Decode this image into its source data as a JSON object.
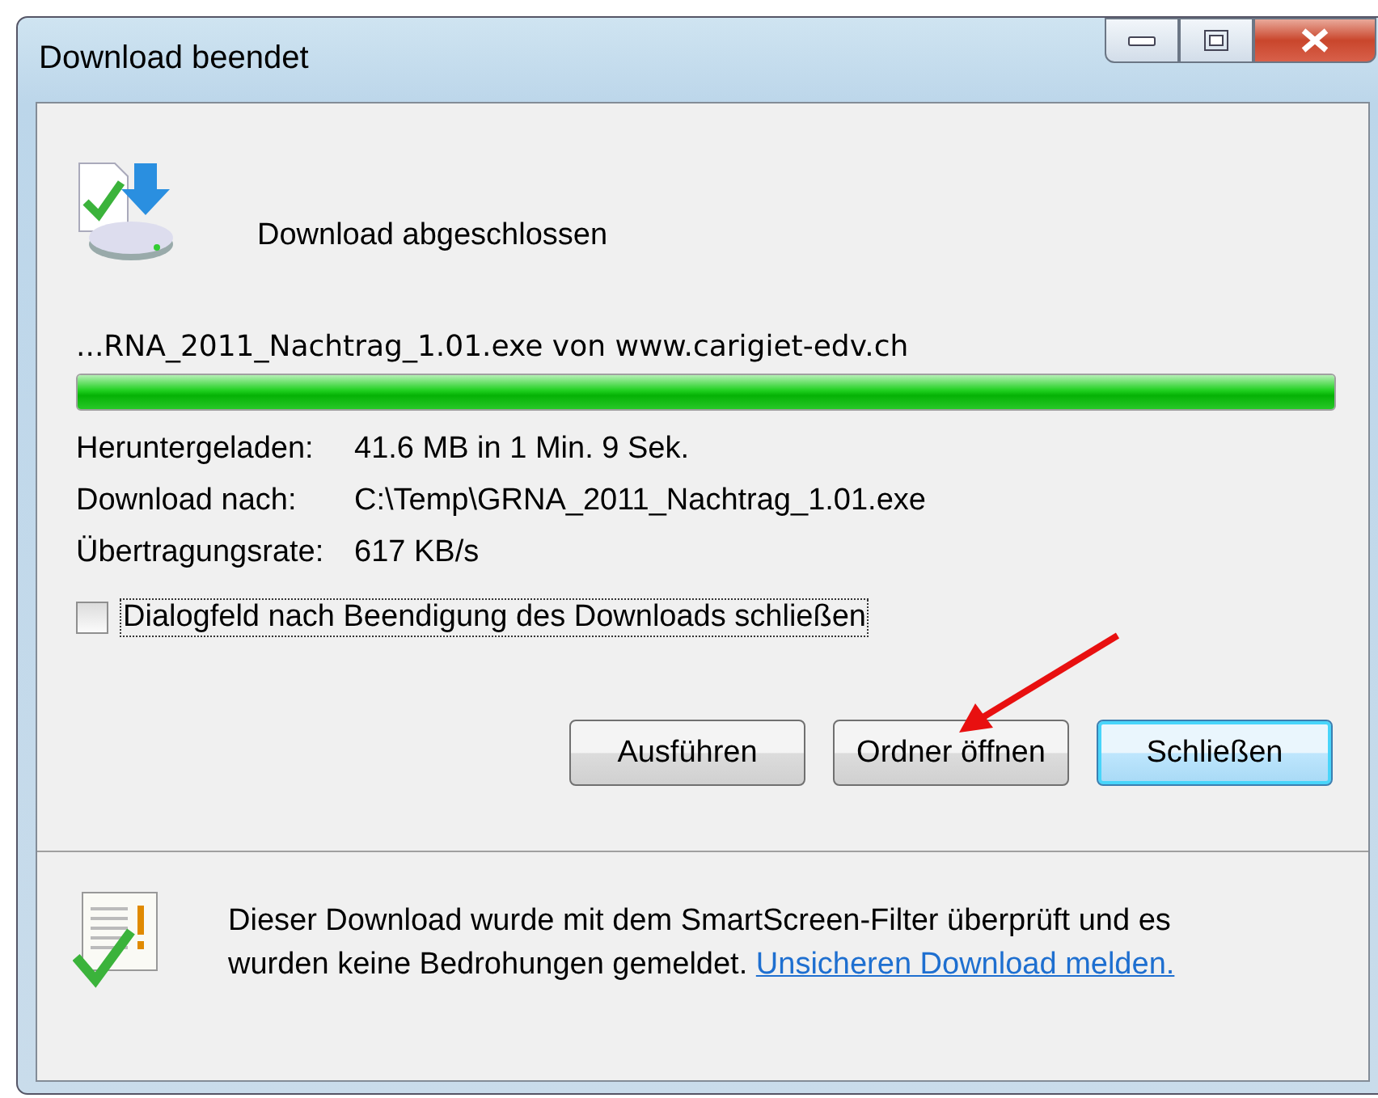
{
  "window": {
    "title": "Download beendet"
  },
  "header": {
    "status": "Download abgeschlossen"
  },
  "file": {
    "source": "...RNA_2011_Nachtrag_1.01.exe von www.carigiet-edv.ch"
  },
  "progress": {
    "level": 1.0
  },
  "details": [
    {
      "label": "Heruntergeladen:",
      "value": "41.6 MB in 1 Min. 9 Sek."
    },
    {
      "label": "Download nach:",
      "value": "C:\\Temp\\GRNA_2011_Nachtrag_1.01.exe"
    },
    {
      "label": "Übertragungsrate:",
      "value": "617 KB/s"
    }
  ],
  "close_when_done": {
    "label": "Dialogfeld nach Beendigung des Downloads schließen",
    "checked": false,
    "focused": true
  },
  "buttons": [
    {
      "label": "Ausführen",
      "default": false
    },
    {
      "label": "Ordner öffnen",
      "default": false
    },
    {
      "label": "Schließen",
      "default": true
    }
  ],
  "footer": {
    "message": "Dieser Download wurde mit dem SmartScreen-Filter überprüft und es wurden keine Bedrohungen gemeldet.",
    "link": "Unsicheren Download melden."
  }
}
